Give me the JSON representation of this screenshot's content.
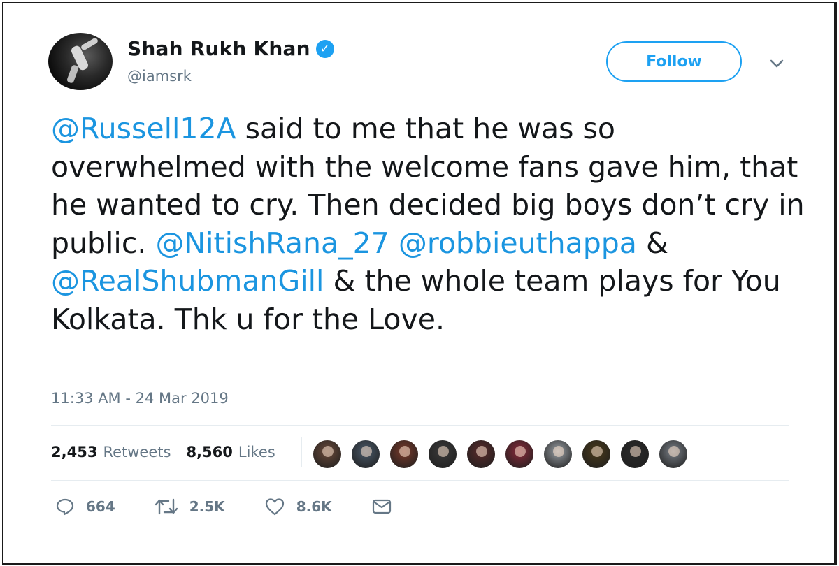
{
  "author": {
    "name": "Shah Rukh Khan",
    "handle": "@iamsrk",
    "verified_icon": "✓"
  },
  "follow_label": "Follow",
  "tweet": {
    "segments": [
      {
        "text": "@Russell12A",
        "mention": true
      },
      {
        "text": " said to me that he was so overwhelmed with the welcome fans gave him, that he wanted to cry. Then decided big boys don’t cry in public. ",
        "mention": false
      },
      {
        "text": "@NitishRana_27",
        "mention": true
      },
      {
        "text": " ",
        "mention": false
      },
      {
        "text": "@robbieuthappa",
        "mention": true
      },
      {
        "text": " & ",
        "mention": false
      },
      {
        "text": "@RealShubmanGill",
        "mention": true
      },
      {
        "text": " & the whole team plays for You Kolkata. Thk u for the Love.",
        "mention": false
      }
    ]
  },
  "timestamp": "11:33 AM - 24 Mar 2019",
  "stats": {
    "retweets_count": "2,453",
    "retweets_label": "Retweets",
    "likes_count": "8,560",
    "likes_label": "Likes"
  },
  "likers": [
    {
      "color": "#6b4a3a"
    },
    {
      "color": "#4a5a6a"
    },
    {
      "color": "#7a3a2a"
    },
    {
      "color": "#3a3a3a"
    },
    {
      "color": "#5a2a2a"
    },
    {
      "color": "#8a2a3a"
    },
    {
      "color": "#9aa0a6"
    },
    {
      "color": "#4a3a1a"
    },
    {
      "color": "#2a2a2a"
    },
    {
      "color": "#7a8088"
    }
  ],
  "actions": {
    "reply_count": "664",
    "retweet_count": "2.5K",
    "like_count": "8.6K"
  },
  "colors": {
    "accent": "#1da1f2",
    "mention": "#1b95e0",
    "text": "#14171a",
    "muted": "#657786"
  },
  "icons": [
    "verified-icon",
    "chevron-down-icon",
    "reply-icon",
    "retweet-icon",
    "heart-icon",
    "mail-icon"
  ]
}
